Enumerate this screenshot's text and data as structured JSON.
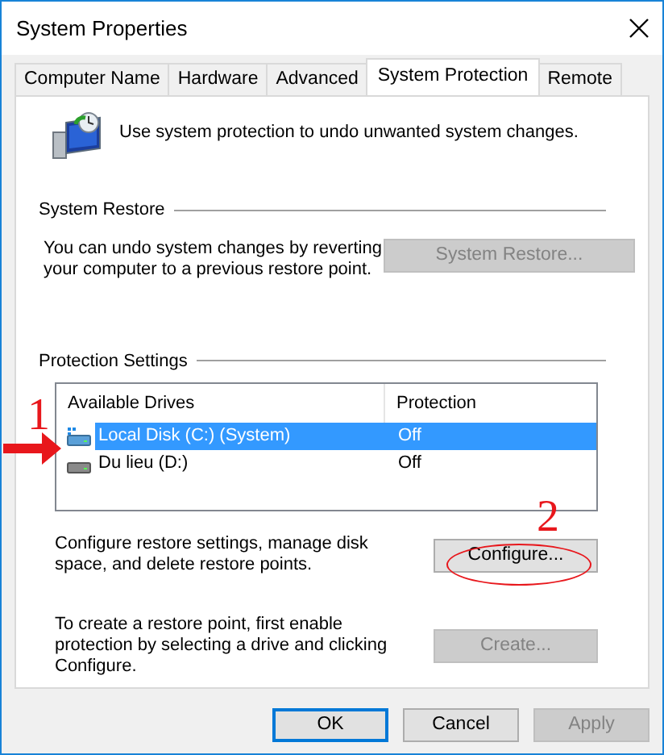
{
  "window": {
    "title": "System Properties"
  },
  "tabs": [
    {
      "label": "Computer Name",
      "selected": false
    },
    {
      "label": "Hardware",
      "selected": false
    },
    {
      "label": "Advanced",
      "selected": false
    },
    {
      "label": "System Protection",
      "selected": true
    },
    {
      "label": "Remote",
      "selected": false
    }
  ],
  "intro": "Use system protection to undo unwanted system changes.",
  "system_restore": {
    "heading": "System Restore",
    "text": "You can undo system changes by reverting your computer to a previous restore point.",
    "button": {
      "label": "System Restore...",
      "disabled": true
    }
  },
  "protection_settings": {
    "heading": "Protection Settings",
    "columns": [
      "Available Drives",
      "Protection"
    ],
    "drives": [
      {
        "name": "Local Disk (C:) (System)",
        "protection": "Off",
        "kind": "system",
        "selected": true
      },
      {
        "name": "Du lieu (D:)",
        "protection": "Off",
        "kind": "data",
        "selected": false
      }
    ],
    "configure": {
      "text": "Configure restore settings, manage disk space, and delete restore points.",
      "button": {
        "label": "Configure...",
        "disabled": false
      }
    },
    "create": {
      "text": "To create a restore point, first enable protection by selecting a drive and clicking Configure.",
      "button": {
        "label": "Create...",
        "disabled": true
      }
    }
  },
  "buttons": [
    {
      "label": "OK",
      "default": true,
      "disabled": false
    },
    {
      "label": "Cancel",
      "default": false,
      "disabled": false
    },
    {
      "label": "Apply",
      "default": false,
      "disabled": true
    }
  ],
  "annotations": [
    {
      "label": "1",
      "kind": "arrow"
    },
    {
      "label": "2",
      "kind": "ellipse"
    }
  ]
}
